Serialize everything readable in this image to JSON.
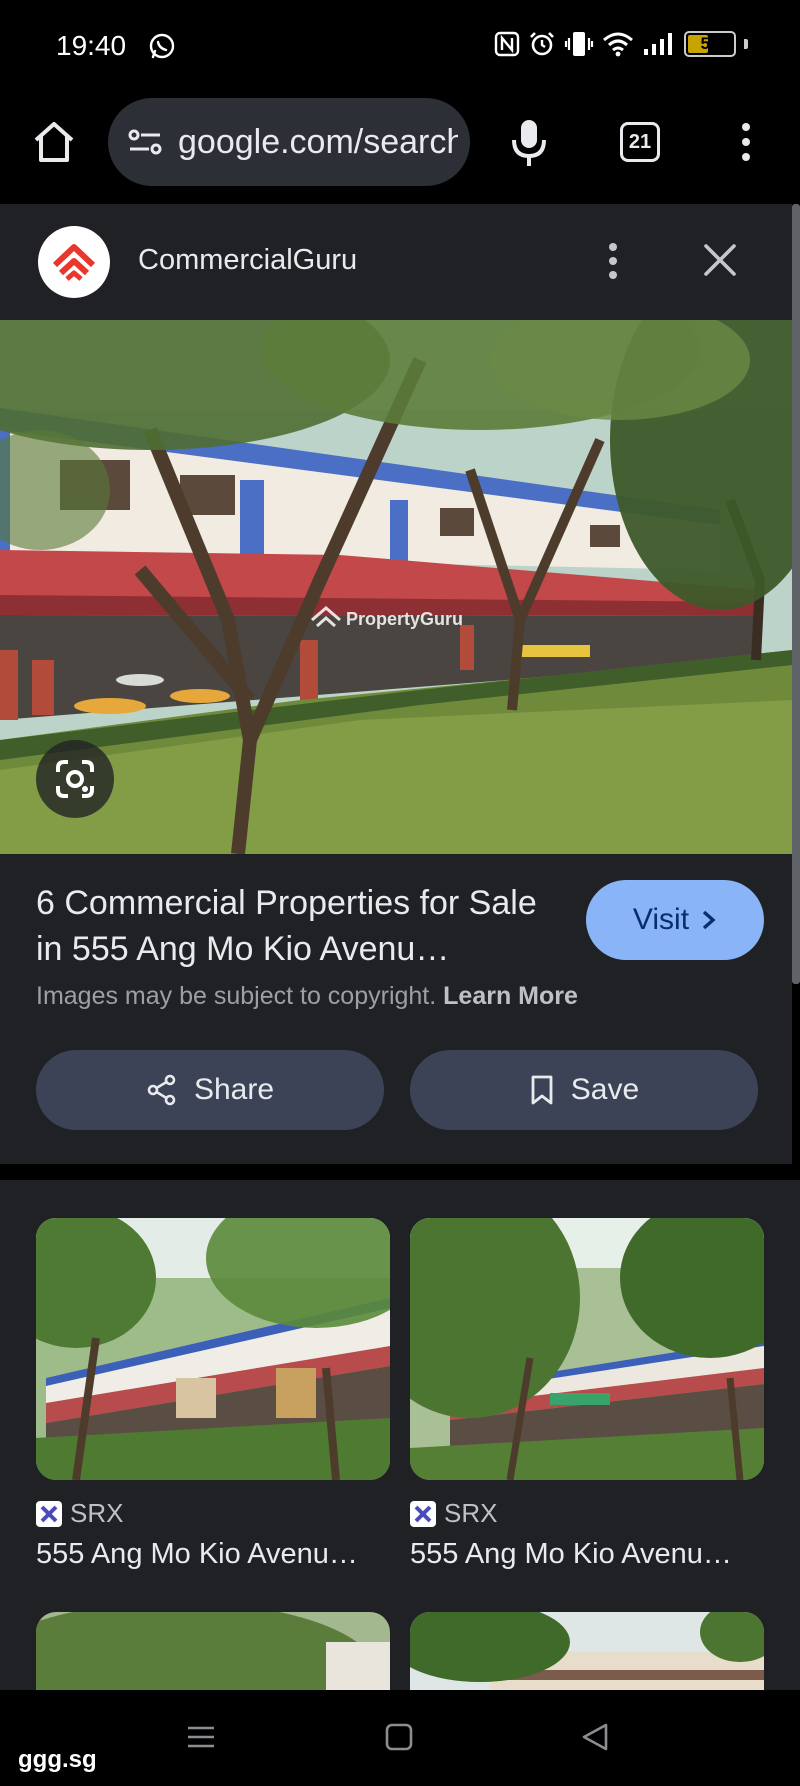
{
  "status_bar": {
    "time": "19:40",
    "battery": "50",
    "battery_level": 0.5,
    "icons": [
      "whatsapp-icon",
      "nfc-icon",
      "alarm-icon",
      "vibrate-icon",
      "wifi-icon",
      "signal-icon",
      "battery-icon"
    ]
  },
  "browser": {
    "url": "google.com/search",
    "tab_count": "21",
    "icons": [
      "home-icon",
      "site-settings-icon",
      "mic-icon",
      "tabs-icon",
      "more-vert-icon"
    ]
  },
  "card": {
    "source_name": "CommercialGuru",
    "watermark": "PropertyGuru",
    "title": "6 Commercial Properties for Sale in 555 Ang Mo Kio Avenu…",
    "visit_label": "Visit",
    "copyright_text": "Images may be subject to copyright.",
    "learn_more": "Learn More",
    "share_label": "Share",
    "save_label": "Save"
  },
  "related": [
    {
      "source": "SRX",
      "title": "555 Ang Mo Kio Avenu…"
    },
    {
      "source": "SRX",
      "title": "555 Ang Mo Kio Avenu…"
    }
  ],
  "footer": {
    "watermark": "ggg.sg"
  },
  "colors": {
    "card_bg": "#202124",
    "visit_bg": "#8ab4f8",
    "button_bg": "#3c4356",
    "brand_red": "#e8372c"
  }
}
